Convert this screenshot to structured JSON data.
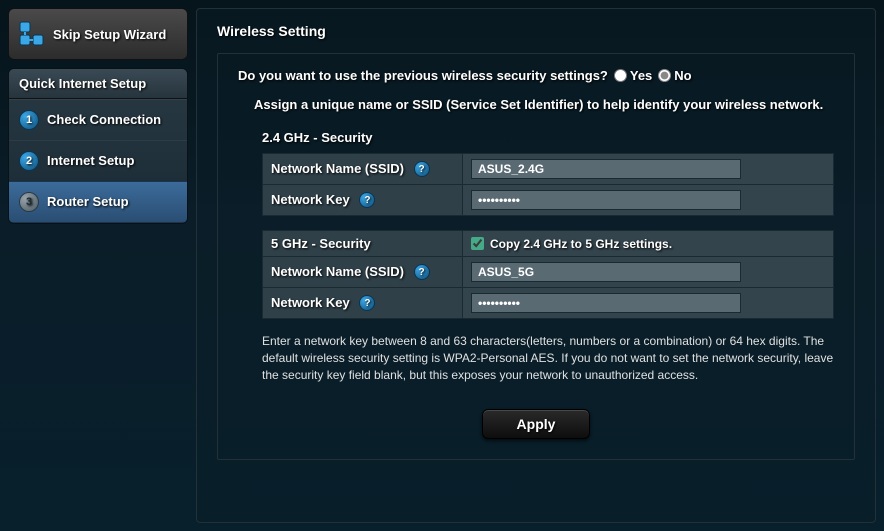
{
  "sidebar": {
    "skip_label": "Skip Setup Wizard",
    "qis_title": "Quick Internet Setup",
    "steps": [
      {
        "num": "1",
        "label": "Check Connection"
      },
      {
        "num": "2",
        "label": "Internet Setup"
      },
      {
        "num": "3",
        "label": "Router Setup"
      }
    ]
  },
  "main": {
    "title": "Wireless Setting",
    "question": "Do you want to use the previous wireless security settings?",
    "yes_label": "Yes",
    "no_label": "No",
    "selected_option": "no",
    "instruction": "Assign a unique name or SSID (Service Set Identifier) to help identify your wireless network.",
    "g24": {
      "title": "2.4 GHz - Security",
      "ssid_label": "Network Name (SSID)",
      "ssid_value": "ASUS_2.4G",
      "key_label": "Network Key",
      "key_value": "••••••••••"
    },
    "g5": {
      "title": "5 GHz - Security",
      "copy_label": "Copy 2.4 GHz to 5 GHz settings.",
      "copy_checked": true,
      "ssid_label": "Network Name (SSID)",
      "ssid_value": "ASUS_5G",
      "key_label": "Network Key",
      "key_value": "••••••••••"
    },
    "note": "Enter a network key between 8 and 63 characters(letters, numbers or a combination) or 64 hex digits. The default wireless security setting is WPA2-Personal AES. If you do not want to set the network security, leave the security key field blank, but this exposes your network to unauthorized access.",
    "apply_label": "Apply"
  }
}
